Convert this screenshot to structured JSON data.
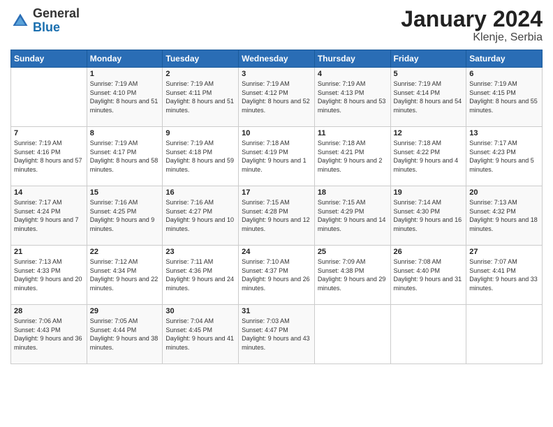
{
  "header": {
    "logo_general": "General",
    "logo_blue": "Blue",
    "month_year": "January 2024",
    "location": "Klenje, Serbia"
  },
  "days_of_week": [
    "Sunday",
    "Monday",
    "Tuesday",
    "Wednesday",
    "Thursday",
    "Friday",
    "Saturday"
  ],
  "weeks": [
    [
      {
        "day": "",
        "sunrise": "",
        "sunset": "",
        "daylight": ""
      },
      {
        "day": "1",
        "sunrise": "Sunrise: 7:19 AM",
        "sunset": "Sunset: 4:10 PM",
        "daylight": "Daylight: 8 hours and 51 minutes."
      },
      {
        "day": "2",
        "sunrise": "Sunrise: 7:19 AM",
        "sunset": "Sunset: 4:11 PM",
        "daylight": "Daylight: 8 hours and 51 minutes."
      },
      {
        "day": "3",
        "sunrise": "Sunrise: 7:19 AM",
        "sunset": "Sunset: 4:12 PM",
        "daylight": "Daylight: 8 hours and 52 minutes."
      },
      {
        "day": "4",
        "sunrise": "Sunrise: 7:19 AM",
        "sunset": "Sunset: 4:13 PM",
        "daylight": "Daylight: 8 hours and 53 minutes."
      },
      {
        "day": "5",
        "sunrise": "Sunrise: 7:19 AM",
        "sunset": "Sunset: 4:14 PM",
        "daylight": "Daylight: 8 hours and 54 minutes."
      },
      {
        "day": "6",
        "sunrise": "Sunrise: 7:19 AM",
        "sunset": "Sunset: 4:15 PM",
        "daylight": "Daylight: 8 hours and 55 minutes."
      }
    ],
    [
      {
        "day": "7",
        "sunrise": "Sunrise: 7:19 AM",
        "sunset": "Sunset: 4:16 PM",
        "daylight": "Daylight: 8 hours and 57 minutes."
      },
      {
        "day": "8",
        "sunrise": "Sunrise: 7:19 AM",
        "sunset": "Sunset: 4:17 PM",
        "daylight": "Daylight: 8 hours and 58 minutes."
      },
      {
        "day": "9",
        "sunrise": "Sunrise: 7:19 AM",
        "sunset": "Sunset: 4:18 PM",
        "daylight": "Daylight: 8 hours and 59 minutes."
      },
      {
        "day": "10",
        "sunrise": "Sunrise: 7:18 AM",
        "sunset": "Sunset: 4:19 PM",
        "daylight": "Daylight: 9 hours and 1 minute."
      },
      {
        "day": "11",
        "sunrise": "Sunrise: 7:18 AM",
        "sunset": "Sunset: 4:21 PM",
        "daylight": "Daylight: 9 hours and 2 minutes."
      },
      {
        "day": "12",
        "sunrise": "Sunrise: 7:18 AM",
        "sunset": "Sunset: 4:22 PM",
        "daylight": "Daylight: 9 hours and 4 minutes."
      },
      {
        "day": "13",
        "sunrise": "Sunrise: 7:17 AM",
        "sunset": "Sunset: 4:23 PM",
        "daylight": "Daylight: 9 hours and 5 minutes."
      }
    ],
    [
      {
        "day": "14",
        "sunrise": "Sunrise: 7:17 AM",
        "sunset": "Sunset: 4:24 PM",
        "daylight": "Daylight: 9 hours and 7 minutes."
      },
      {
        "day": "15",
        "sunrise": "Sunrise: 7:16 AM",
        "sunset": "Sunset: 4:25 PM",
        "daylight": "Daylight: 9 hours and 9 minutes."
      },
      {
        "day": "16",
        "sunrise": "Sunrise: 7:16 AM",
        "sunset": "Sunset: 4:27 PM",
        "daylight": "Daylight: 9 hours and 10 minutes."
      },
      {
        "day": "17",
        "sunrise": "Sunrise: 7:15 AM",
        "sunset": "Sunset: 4:28 PM",
        "daylight": "Daylight: 9 hours and 12 minutes."
      },
      {
        "day": "18",
        "sunrise": "Sunrise: 7:15 AM",
        "sunset": "Sunset: 4:29 PM",
        "daylight": "Daylight: 9 hours and 14 minutes."
      },
      {
        "day": "19",
        "sunrise": "Sunrise: 7:14 AM",
        "sunset": "Sunset: 4:30 PM",
        "daylight": "Daylight: 9 hours and 16 minutes."
      },
      {
        "day": "20",
        "sunrise": "Sunrise: 7:13 AM",
        "sunset": "Sunset: 4:32 PM",
        "daylight": "Daylight: 9 hours and 18 minutes."
      }
    ],
    [
      {
        "day": "21",
        "sunrise": "Sunrise: 7:13 AM",
        "sunset": "Sunset: 4:33 PM",
        "daylight": "Daylight: 9 hours and 20 minutes."
      },
      {
        "day": "22",
        "sunrise": "Sunrise: 7:12 AM",
        "sunset": "Sunset: 4:34 PM",
        "daylight": "Daylight: 9 hours and 22 minutes."
      },
      {
        "day": "23",
        "sunrise": "Sunrise: 7:11 AM",
        "sunset": "Sunset: 4:36 PM",
        "daylight": "Daylight: 9 hours and 24 minutes."
      },
      {
        "day": "24",
        "sunrise": "Sunrise: 7:10 AM",
        "sunset": "Sunset: 4:37 PM",
        "daylight": "Daylight: 9 hours and 26 minutes."
      },
      {
        "day": "25",
        "sunrise": "Sunrise: 7:09 AM",
        "sunset": "Sunset: 4:38 PM",
        "daylight": "Daylight: 9 hours and 29 minutes."
      },
      {
        "day": "26",
        "sunrise": "Sunrise: 7:08 AM",
        "sunset": "Sunset: 4:40 PM",
        "daylight": "Daylight: 9 hours and 31 minutes."
      },
      {
        "day": "27",
        "sunrise": "Sunrise: 7:07 AM",
        "sunset": "Sunset: 4:41 PM",
        "daylight": "Daylight: 9 hours and 33 minutes."
      }
    ],
    [
      {
        "day": "28",
        "sunrise": "Sunrise: 7:06 AM",
        "sunset": "Sunset: 4:43 PM",
        "daylight": "Daylight: 9 hours and 36 minutes."
      },
      {
        "day": "29",
        "sunrise": "Sunrise: 7:05 AM",
        "sunset": "Sunset: 4:44 PM",
        "daylight": "Daylight: 9 hours and 38 minutes."
      },
      {
        "day": "30",
        "sunrise": "Sunrise: 7:04 AM",
        "sunset": "Sunset: 4:45 PM",
        "daylight": "Daylight: 9 hours and 41 minutes."
      },
      {
        "day": "31",
        "sunrise": "Sunrise: 7:03 AM",
        "sunset": "Sunset: 4:47 PM",
        "daylight": "Daylight: 9 hours and 43 minutes."
      },
      {
        "day": "",
        "sunrise": "",
        "sunset": "",
        "daylight": ""
      },
      {
        "day": "",
        "sunrise": "",
        "sunset": "",
        "daylight": ""
      },
      {
        "day": "",
        "sunrise": "",
        "sunset": "",
        "daylight": ""
      }
    ]
  ]
}
